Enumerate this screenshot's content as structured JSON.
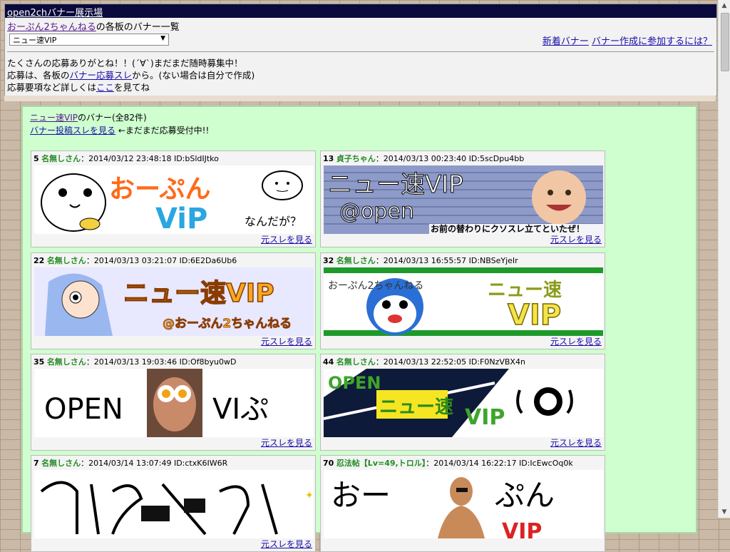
{
  "header": {
    "title": "open2chバナー展示場",
    "site_link": "おーぷん2ちゃんねる",
    "site_suffix": "の各板のバナー一覧",
    "board_selected": "ニュー速VIP",
    "new_banner": "新着バナー",
    "join_link": "バナー作成に参加するには？",
    "notice_line1": "たくさんの応募ありがとね！！(´∀`)まだまだ随時募集中！",
    "notice_line2_prefix": "応募は、各板の",
    "notice_line2_link": "バナー応募スレ",
    "notice_line2_suffix": "から。(ない場合は自分で作成)",
    "notice_line3_prefix": "応募要項など詳しくは",
    "notice_line3_link": "ここ",
    "notice_line3_suffix": "を見てね"
  },
  "main": {
    "board_link": "ニュー速VIP",
    "board_suffix": "のバナー(全82件)",
    "post_link": "バナー投稿スレを見る",
    "post_suffix": " ←まだまだ応募受付中!!"
  },
  "source_label": "元スレを見る",
  "cards": [
    {
      "num": "5",
      "name": "名無しさん",
      "info": "：2014/03/12 23:48:18 ID:bSldIJtko",
      "banner_text": [
        "おーぷん",
        "ViP",
        "なんだが？"
      ]
    },
    {
      "num": "13",
      "name": "貞子ちゃん",
      "info": "：2014/03/13 00:23:40 ID:5scDpu4bb",
      "banner_text": [
        "ニュー速VIP",
        "@open",
        "お前の替わりにクソスレ立てといたぜ！"
      ]
    },
    {
      "num": "22",
      "name": "名無しさん",
      "info": "：2014/03/13 03:21:07 ID:6E2Da6Ub6",
      "banner_text": [
        "ニュー速VIP",
        "@おーぷん2ちゃんねる"
      ]
    },
    {
      "num": "32",
      "name": "名無しさん",
      "info": "：2014/03/13 16:55:57 ID:NBSeYjeIr",
      "banner_text": [
        "おーぷん2ちゃんねる",
        "ニュー速",
        "VIP"
      ]
    },
    {
      "num": "35",
      "name": "名無しさん",
      "info": "：2014/03/13 19:03:46 ID:Of8byu0wD",
      "banner_text": [
        "OPEN",
        "VIぷ"
      ]
    },
    {
      "num": "44",
      "name": "名無しさん",
      "info": "：2014/03/13 22:52:05 ID:F0NzVBX4n",
      "banner_text": [
        "OPEN",
        "ニュー速",
        "VIP"
      ]
    },
    {
      "num": "7",
      "name": "名無しさん",
      "info": "：2014/03/14 13:07:49 ID:ctxK6IW6R",
      "banner_text": []
    },
    {
      "num": "70",
      "name": "忍法帖【Lv=49,トロル】",
      "info": "：2014/03/14 16:22:17 ID:IcEwcOq0k",
      "banner_text": [
        "おー",
        "ぷん",
        "VIP"
      ]
    }
  ],
  "colors": {
    "name_green": "#228b22",
    "bg_green": "#cfffcf",
    "header_navy": "#0a0a3c"
  }
}
